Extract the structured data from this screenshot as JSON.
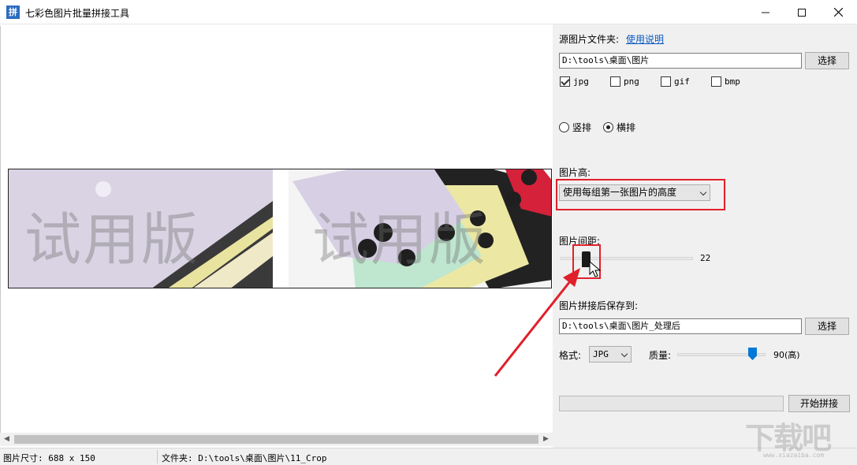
{
  "window": {
    "title": "七彩色图片批量拼接工具",
    "app_icon_char": "拼"
  },
  "canvas": {
    "watermark_left": "试用版",
    "watermark_right": "试用版"
  },
  "status": {
    "size_label": "图片尺寸: 688 x 150",
    "folder_label": "文件夹: D:\\tools\\桌面\\图片\\11_Crop"
  },
  "panel": {
    "source_label": "源图片文件夹:",
    "help_link": "使用说明",
    "source_path": "D:\\tools\\桌面\\图片",
    "browse_label": "选择",
    "formats": [
      {
        "label": "jpg",
        "checked": true
      },
      {
        "label": "png",
        "checked": false
      },
      {
        "label": "gif",
        "checked": false
      },
      {
        "label": "bmp",
        "checked": false
      }
    ],
    "orientation": {
      "vertical": "竖排",
      "horizontal": "横排",
      "selected": "horizontal"
    },
    "height_label": "图片高:",
    "height_option": "使用每组第一张图片的高度",
    "spacing_label": "图片间距:",
    "spacing_value": "22",
    "output_label": "图片拼接后保存到:",
    "output_path": "D:\\tools\\桌面\\图片_处理后",
    "output_browse_label": "选择",
    "format_label": "格式:",
    "format_value": "JPG",
    "quality_label": "质量:",
    "quality_value": "90(高)",
    "progress": 0,
    "start_label": "开始拼接"
  },
  "colors": {
    "annotation_red": "#e0202a",
    "accent_blue": "#0078d7",
    "link_blue": "#0a58c2"
  },
  "branding": {
    "mark": "下载吧",
    "sub": "www.xiazaiba.com"
  }
}
